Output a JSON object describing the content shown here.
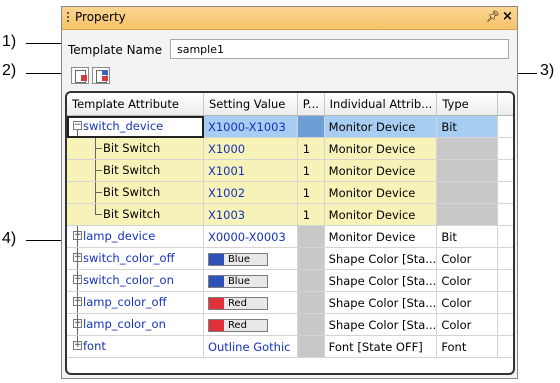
{
  "callouts": [
    "1)",
    "2)",
    "3)",
    "4)"
  ],
  "panel": {
    "title": "Property"
  },
  "template_name": {
    "label": "Template Name",
    "value": "sample1"
  },
  "toolbar": {
    "buttons": [
      "sort-by-name-icon",
      "sort-by-category-icon"
    ]
  },
  "grid": {
    "headers": [
      "Template Attribute",
      "Setting Value",
      "P...",
      "Individual Attrib...",
      "Type"
    ],
    "rows": [
      {
        "name": "switch_device",
        "value": "X1000-X1003",
        "p": "",
        "attr": "Monitor Device",
        "type": "Bit"
      },
      {
        "name": "Bit Switch",
        "value": "X1000",
        "p": "1",
        "attr": "Monitor Device",
        "type": ""
      },
      {
        "name": "Bit Switch",
        "value": "X1001",
        "p": "1",
        "attr": "Monitor Device",
        "type": ""
      },
      {
        "name": "Bit Switch",
        "value": "X1002",
        "p": "1",
        "attr": "Monitor Device",
        "type": ""
      },
      {
        "name": "Bit Switch",
        "value": "X1003",
        "p": "1",
        "attr": "Monitor Device",
        "type": ""
      },
      {
        "name": "lamp_device",
        "value": "X0000-X0003",
        "p": "",
        "attr": "Monitor Device",
        "type": "Bit"
      },
      {
        "name": "switch_color_off",
        "value": "Blue",
        "p": "",
        "attr": "Shape Color [Sta...",
        "type": "Color",
        "swatch": "#2f52b8"
      },
      {
        "name": "switch_color_on",
        "value": "Blue",
        "p": "",
        "attr": "Shape Color [Sta...",
        "type": "Color",
        "swatch": "#2f52b8"
      },
      {
        "name": "lamp_color_off",
        "value": "Red",
        "p": "",
        "attr": "Shape Color [Sta...",
        "type": "Color",
        "swatch": "#e0313a"
      },
      {
        "name": "lamp_color_on",
        "value": "Red",
        "p": "",
        "attr": "Shape Color [Sta...",
        "type": "Color",
        "swatch": "#e0313a"
      },
      {
        "name": "font",
        "value": "Outline Gothic",
        "p": "",
        "attr": "Font [State OFF]",
        "type": "Font"
      }
    ]
  },
  "colors": {
    "title_bar": "#f5c46b",
    "selected_row": "#a8cdf2",
    "child_row": "#f7f2b8",
    "link_text": "#1533b8"
  }
}
